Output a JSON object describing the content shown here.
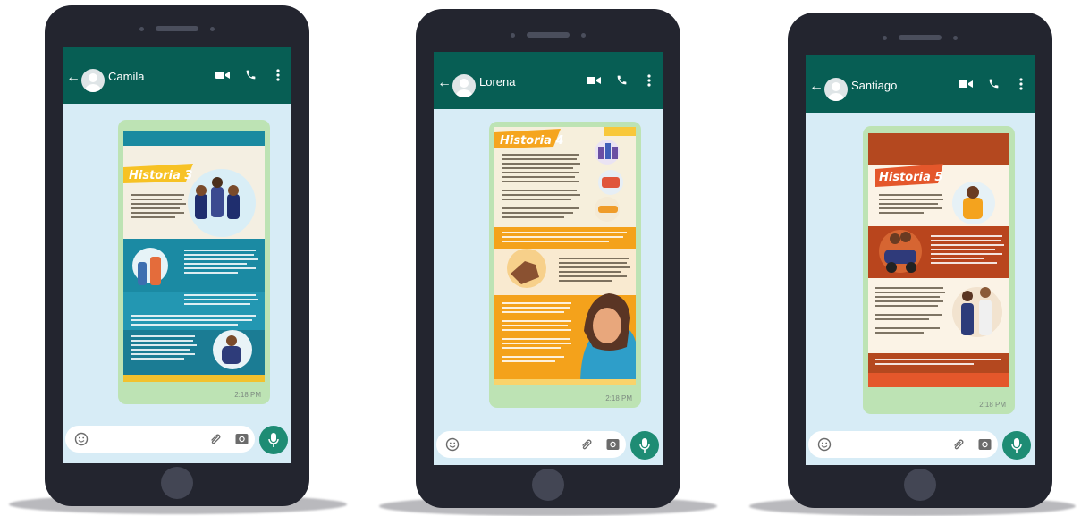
{
  "phones": [
    {
      "contact": "Camila",
      "story_title": "Historia 3",
      "time": "2:18 PM"
    },
    {
      "contact": "Lorena",
      "story_title": "Historia 4",
      "time": "2:18 PM"
    },
    {
      "contact": "Santiago",
      "story_title": "Historia 5",
      "time": "2:18 PM"
    }
  ],
  "colors": {
    "whatsapp_header": "#075e54",
    "chat_background": "#d7ecf6",
    "message_bubble": "#bde3b4",
    "mic_button": "#1e8c74",
    "phone_body": "#23252f"
  },
  "icons": [
    "back-arrow-icon",
    "avatar-icon",
    "video-call-icon",
    "phone-call-icon",
    "more-options-icon",
    "emoji-icon",
    "attach-icon",
    "camera-icon",
    "microphone-icon"
  ]
}
